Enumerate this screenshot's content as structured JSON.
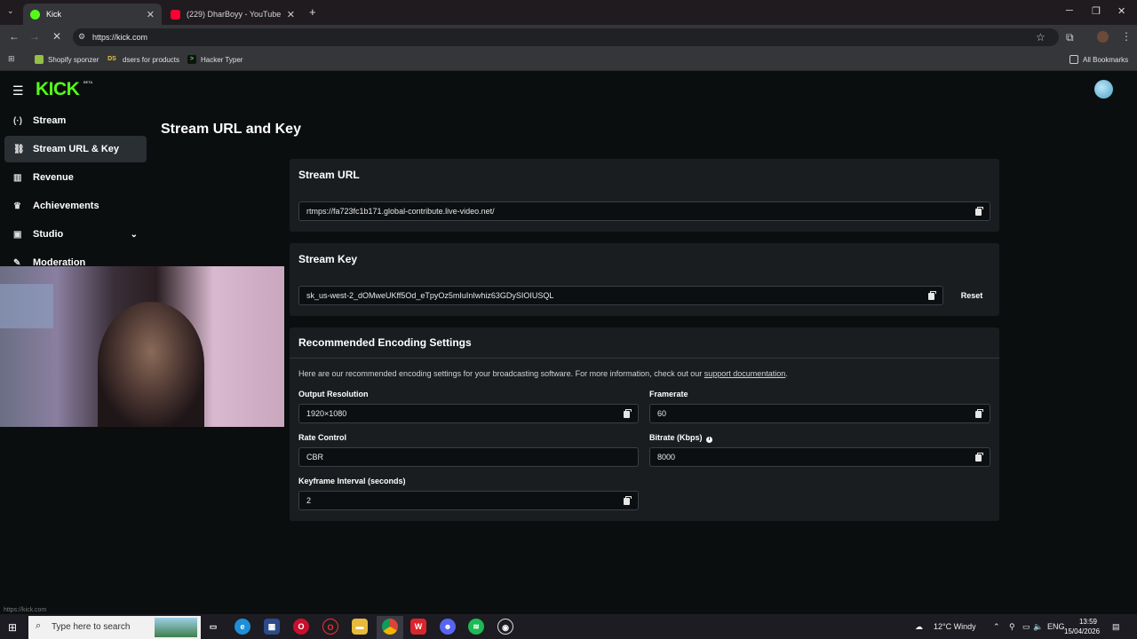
{
  "browser": {
    "tabs": [
      {
        "title": "Kick",
        "active": true
      },
      {
        "title": "(229) DharBoyy - YouTube",
        "active": false
      }
    ],
    "url": "https://kick.com",
    "bookmarks": [
      "Shopify sponzer",
      "dsers for products",
      "Hacker Typer"
    ],
    "all_bookmarks_label": "All Bookmarks",
    "status_url": "https://kick.com"
  },
  "header": {
    "logo": "KICK",
    "logo_badge": "BETA"
  },
  "sidebar": {
    "items": [
      {
        "label": "Stream",
        "icon": "broadcast-icon"
      },
      {
        "label": "Stream URL & Key",
        "icon": "link-icon",
        "active": true
      },
      {
        "label": "Revenue",
        "icon": "chart-icon"
      },
      {
        "label": "Achievements",
        "icon": "trophy-icon"
      },
      {
        "label": "Studio",
        "icon": "studio-icon",
        "expandable": true
      },
      {
        "label": "Moderation",
        "icon": "wrench-icon"
      }
    ]
  },
  "main": {
    "title": "Stream URL and Key",
    "stream_url": {
      "title": "Stream URL",
      "value": "rtmps://fa723fc1b171.global-contribute.live-video.net/"
    },
    "stream_key": {
      "title": "Stream Key",
      "value": "sk_us-west-2_dOMweUKff5Od_eTpyOz5mIuInIwhiz63GDySIOIUSQL",
      "reset_label": "Reset"
    },
    "encoding": {
      "title": "Recommended Encoding Settings",
      "help_text": "Here are our recommended encoding settings for your broadcasting software. For more information, check out our",
      "help_link": "support documentation",
      "help_end": ".",
      "fields": {
        "output_resolution": {
          "label": "Output Resolution",
          "value": "1920×1080"
        },
        "framerate": {
          "label": "Framerate",
          "value": "60"
        },
        "rate_control": {
          "label": "Rate Control",
          "value": "CBR"
        },
        "bitrate": {
          "label": "Bitrate (Kbps)",
          "value": "8000"
        },
        "keyframe": {
          "label": "Keyframe Interval (seconds)",
          "value": "2"
        }
      }
    }
  },
  "taskbar": {
    "search_placeholder": "Type here to search",
    "weather": "12°C  Windy",
    "language": "ENG",
    "time": "13:59",
    "date": "15/04/2026"
  },
  "colors": {
    "brand": "#53fc18",
    "background": "#0b0e0f",
    "card": "#1a1d20"
  }
}
